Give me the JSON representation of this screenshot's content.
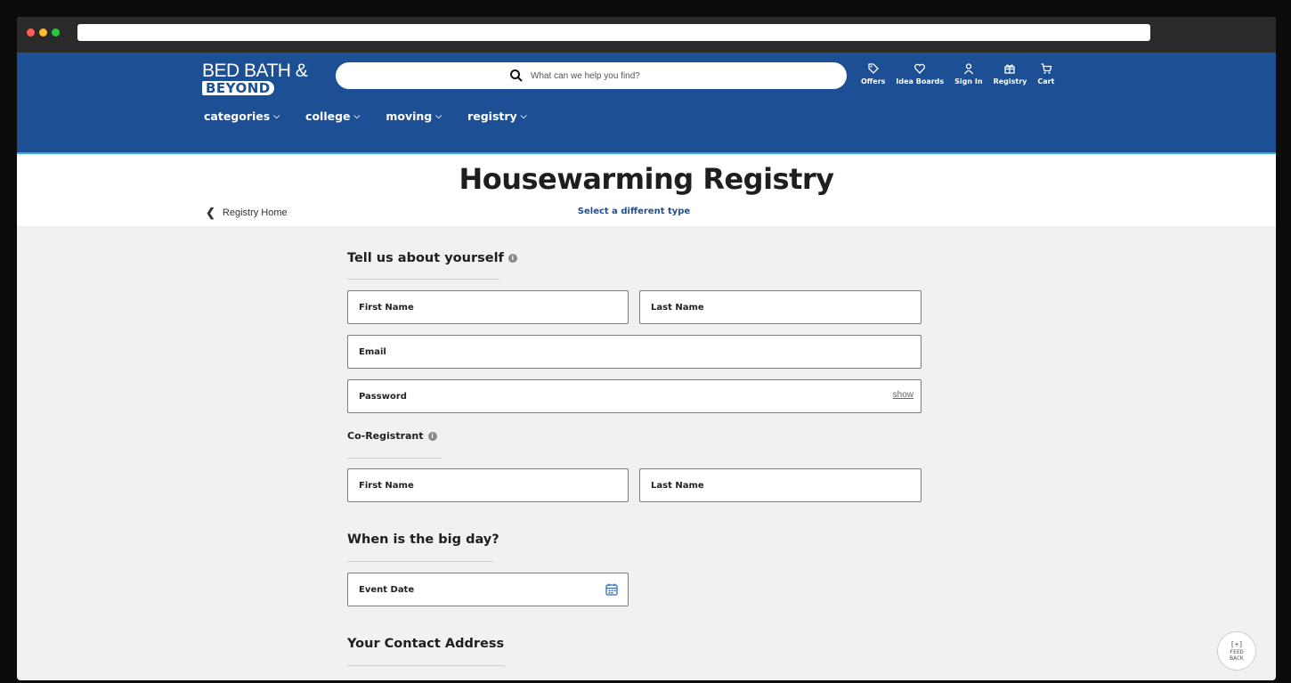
{
  "brand": {
    "line1": "BED BATH &",
    "line2": "BEYOND"
  },
  "search": {
    "placeholder": "What can we help you find?"
  },
  "toplinks": [
    {
      "label": "Offers",
      "icon": "tag-icon"
    },
    {
      "label": "Idea Boards",
      "icon": "heart-icon"
    },
    {
      "label": "Sign In",
      "icon": "person-icon"
    },
    {
      "label": "Registry",
      "icon": "gift-icon"
    },
    {
      "label": "Cart",
      "icon": "cart-icon"
    }
  ],
  "nav": [
    {
      "label": "categories"
    },
    {
      "label": "college"
    },
    {
      "label": "moving"
    },
    {
      "label": "registry"
    }
  ],
  "page": {
    "title": "Housewarming Registry",
    "back_label": "Registry Home",
    "change_type": "Select a different type"
  },
  "form": {
    "about_heading": "Tell us about yourself",
    "first_name": "First Name",
    "last_name": "Last Name",
    "email": "Email",
    "password": "Password",
    "show": "show",
    "coregistrant_heading": "Co-Registrant",
    "co_first_name": "First Name",
    "co_last_name": "Last Name",
    "date_heading": "When is the big day?",
    "event_date": "Event Date",
    "address_heading": "Your Contact Address"
  },
  "feedback": {
    "line1": "[+]",
    "line2": "FEED",
    "line3": "BACK"
  },
  "colors": {
    "header": "#1c4f94",
    "accent": "#3fa9c9",
    "background": "#f1f1f1"
  }
}
